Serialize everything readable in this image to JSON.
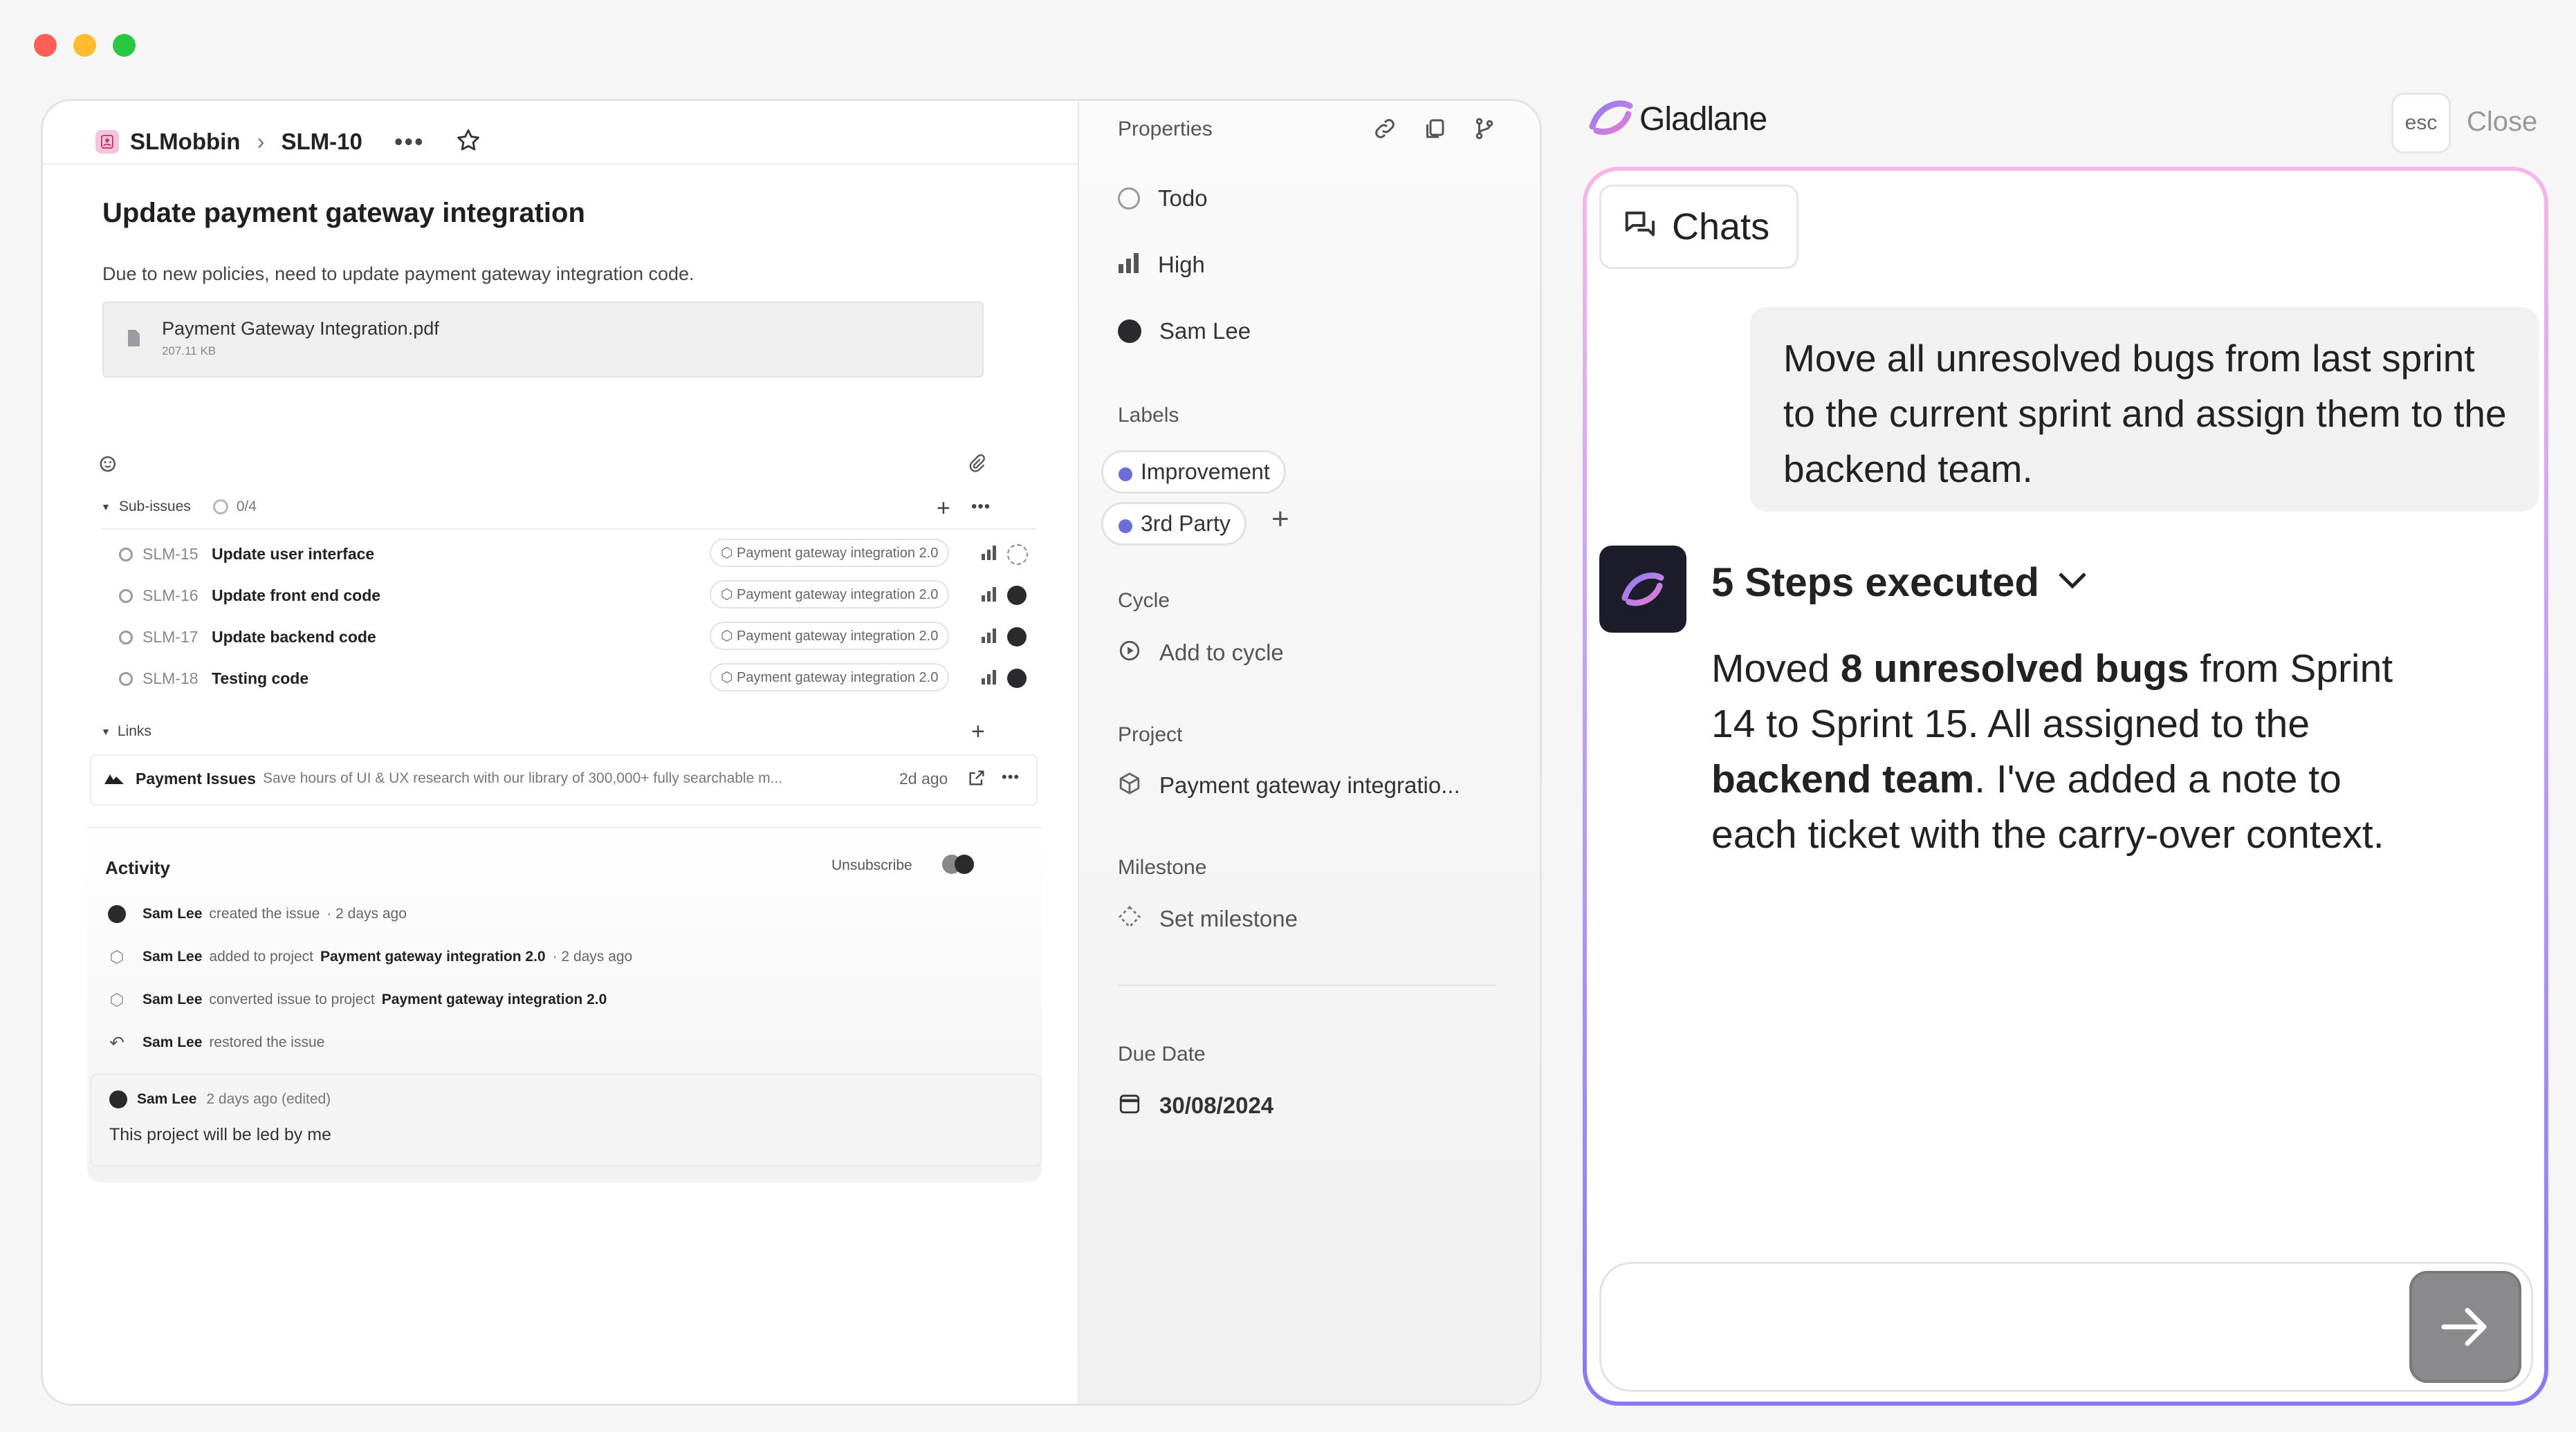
{
  "window": {
    "traffic_lights": [
      "#ff5f57",
      "#febc2e",
      "#28c840"
    ]
  },
  "breadcrumb": {
    "workspace": "SLMobbin",
    "separator": "›",
    "issue_id": "SLM-10"
  },
  "issue": {
    "title": "Update payment gateway integration",
    "description": "Due to new policies, need to update payment gateway integration code.",
    "attachment": {
      "name": "Payment Gateway Integration.pdf",
      "size": "207.11 KB"
    }
  },
  "subissues": {
    "label": "Sub-issues",
    "progress": "0/4",
    "items": [
      {
        "id": "SLM-15",
        "title": "Update user interface",
        "project": "Payment gateway integration 2.0"
      },
      {
        "id": "SLM-16",
        "title": "Update front end code",
        "project": "Payment gateway integration 2.0"
      },
      {
        "id": "SLM-17",
        "title": "Update backend code",
        "project": "Payment gateway integration 2.0"
      },
      {
        "id": "SLM-18",
        "title": "Testing code",
        "project": "Payment gateway integration 2.0"
      }
    ]
  },
  "links": {
    "label": "Links",
    "items": [
      {
        "title": "Payment Issues",
        "description": "Save hours of UI & UX research with our library of 300,000+ fully searchable m...",
        "time": "2d ago"
      }
    ]
  },
  "activity": {
    "title": "Activity",
    "unsubscribe": "Unsubscribe",
    "events": [
      {
        "user": "Sam Lee",
        "text": "created the issue",
        "extra": "",
        "time": "· 2 days ago"
      },
      {
        "user": "Sam Lee",
        "text": "added to project",
        "extra": "Payment gateway integration 2.0",
        "time": "· 2 days ago"
      },
      {
        "user": "Sam Lee",
        "text": "converted issue to project",
        "extra": "Payment gateway integration 2.0",
        "time": ""
      },
      {
        "user": "Sam Lee",
        "text": "restored the issue",
        "extra": "",
        "time": ""
      }
    ],
    "comment": {
      "user": "Sam Lee",
      "meta": "2 days ago (edited)",
      "text": "This project will be led by me"
    }
  },
  "properties": {
    "title": "Properties",
    "status": "Todo",
    "priority": "High",
    "assignee": "Sam Lee",
    "labels_title": "Labels",
    "labels": [
      "Improvement",
      "3rd Party"
    ],
    "cycle_title": "Cycle",
    "cycle": "Add to cycle",
    "project_title": "Project",
    "project": "Payment gateway integratio...",
    "milestone_title": "Milestone",
    "milestone": "Set milestone",
    "due_title": "Due Date",
    "due": "30/08/2024"
  },
  "assistant": {
    "brand": "Gladlane",
    "esc": "esc",
    "close": "Close",
    "chats_tab": "Chats",
    "user_message": "Move all unresolved bugs from last sprint to the current sprint and assign them to the backend team.",
    "steps": "5 Steps executed",
    "response": {
      "p1": "Moved ",
      "b1": "8 unresolved bugs",
      "p2": " from Sprint 14 to Sprint 15. All assigned to the ",
      "b2": "backend team",
      "p3": ". I've added a note to each ticket with the carry-over context."
    },
    "input_placeholder": ""
  }
}
